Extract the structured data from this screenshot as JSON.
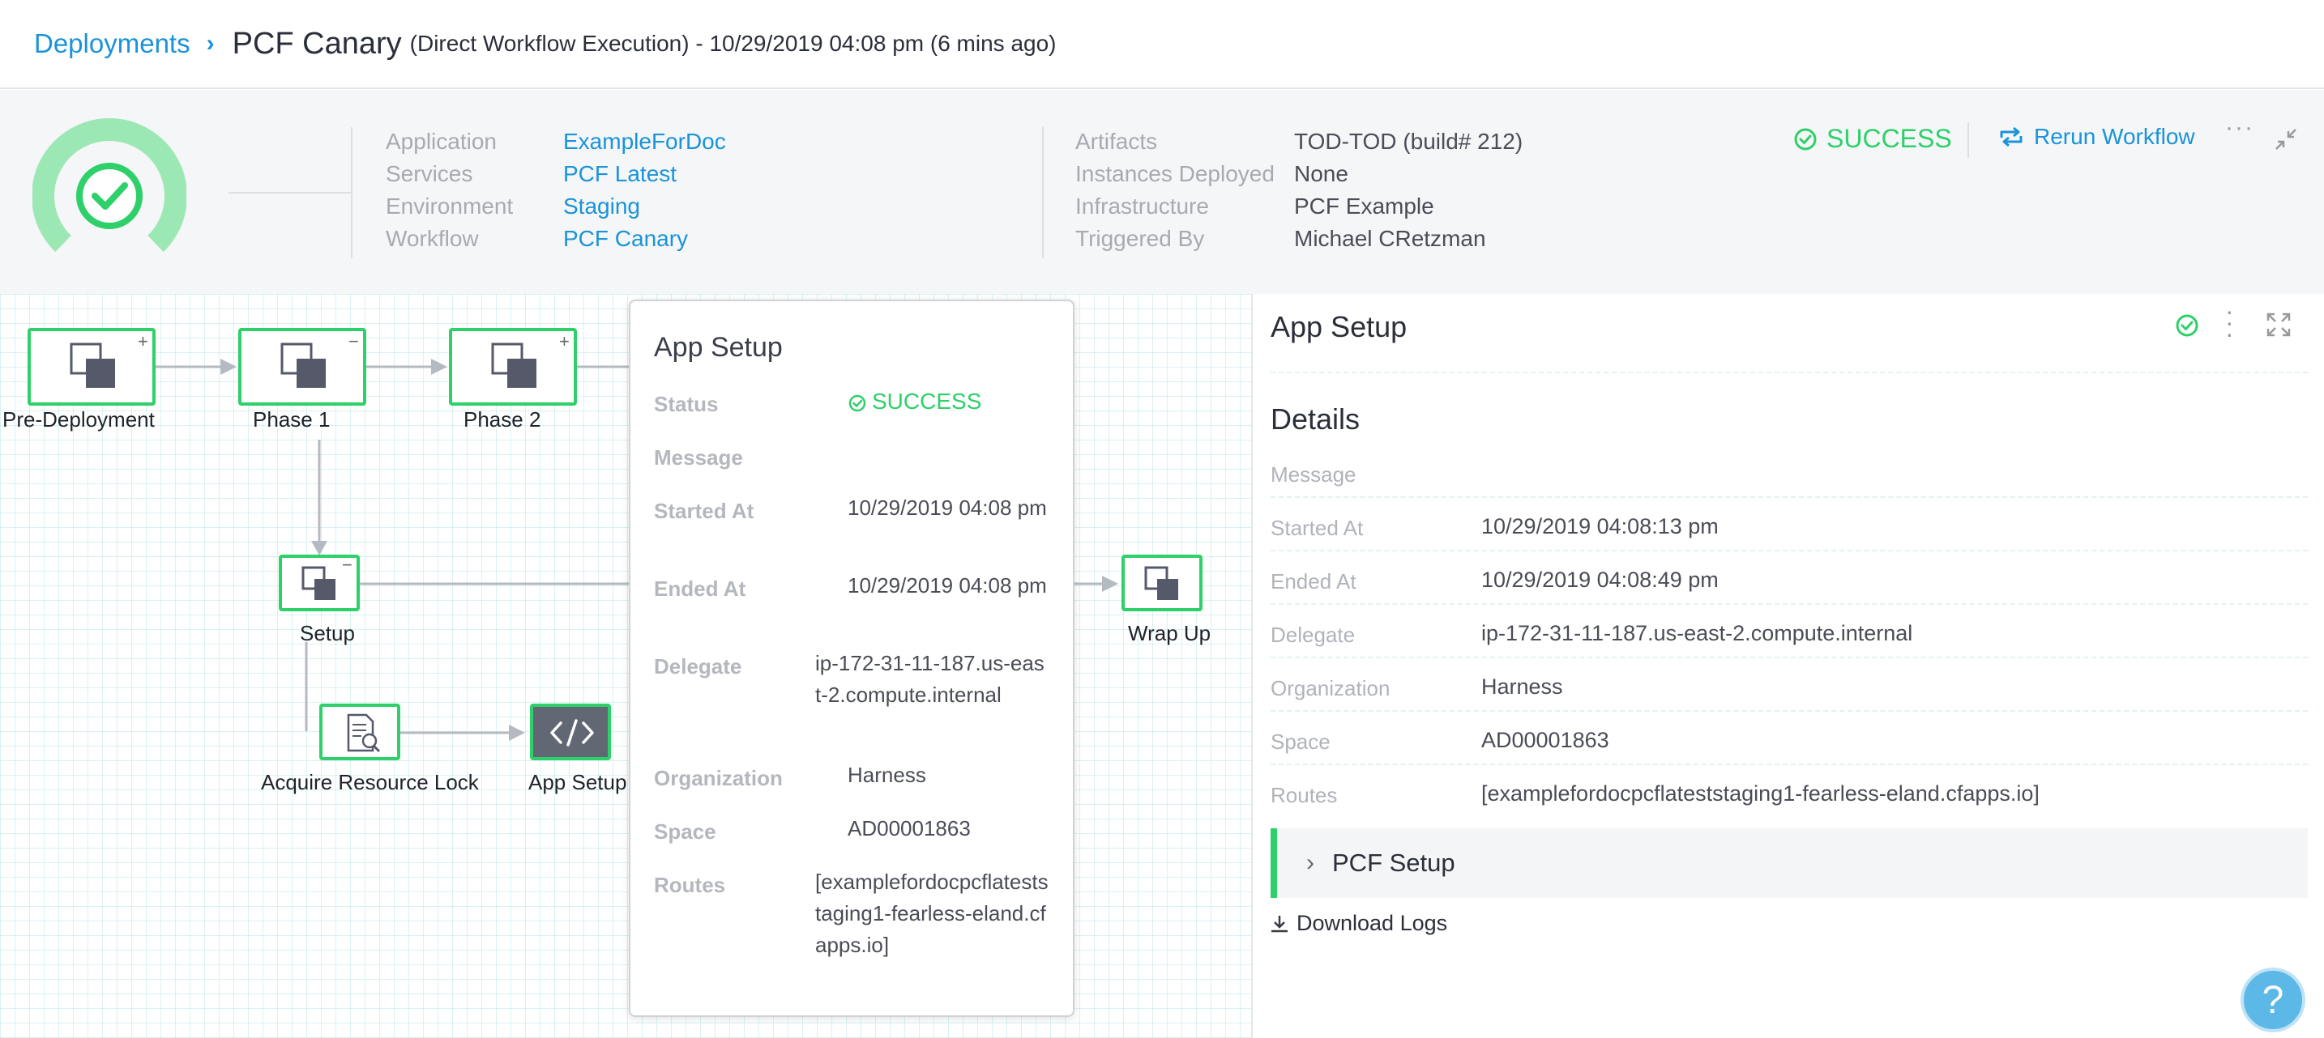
{
  "breadcrumb": {
    "root": "Deployments",
    "title": "PCF Canary",
    "subtitle": "(Direct Workflow Execution) - 10/29/2019 04:08 pm (6 mins ago)"
  },
  "summary": {
    "application_label": "Application",
    "application": "ExampleForDoc",
    "services_label": "Services",
    "services": "PCF Latest",
    "environment_label": "Environment",
    "environment": "Staging",
    "workflow_label": "Workflow",
    "workflow": "PCF Canary",
    "artifacts_label": "Artifacts",
    "artifacts": "TOD-TOD (build# 212)",
    "instances_label": "Instances Deployed",
    "instances": "None",
    "infrastructure_label": "Infrastructure",
    "infrastructure": "PCF Example",
    "triggered_label": "Triggered By",
    "triggered": "Michael CRetzman",
    "status": "SUCCESS",
    "rerun_label": "Rerun Workflow"
  },
  "graph": {
    "nodes": {
      "pre_deployment": "Pre-Deployment",
      "phase1": "Phase 1",
      "phase2": "Phase 2",
      "setup": "Setup",
      "wrap_up": "Wrap Up",
      "acquire_lock": "Acquire Resource Lock",
      "app_setup": "App Setup"
    },
    "toggles": {
      "plus": "+",
      "minus": "−"
    }
  },
  "popover": {
    "title": "App Setup",
    "status_label": "Status",
    "status": "SUCCESS",
    "message_label": "Message",
    "started_label": "Started At",
    "started": "10/29/2019 04:08 pm",
    "ended_label": "Ended At",
    "ended": "10/29/2019 04:08 pm",
    "delegate_label": "Delegate",
    "delegate": "ip-172-31-11-187.us-east-2.compute.internal",
    "organization_label": "Organization",
    "organization": "Harness",
    "space_label": "Space",
    "space": "AD00001863",
    "routes_label": "Routes",
    "routes": "[examplefordocpcflateststaging1-fearless-eland.cfapps.io]"
  },
  "details": {
    "title": "App Setup",
    "section": "Details",
    "message_label": "Message",
    "started_label": "Started At",
    "started": "10/29/2019 04:08:13 pm",
    "ended_label": "Ended At",
    "ended": "10/29/2019 04:08:49 pm",
    "delegate_label": "Delegate",
    "delegate": "ip-172-31-11-187.us-east-2.compute.internal",
    "organization_label": "Organization",
    "organization": "Harness",
    "space_label": "Space",
    "space": "AD00001863",
    "routes_label": "Routes",
    "routes": "[examplefordocpcflateststaging1-fearless-eland.cfapps.io]",
    "accordion": "PCF Setup",
    "download": "Download Logs"
  },
  "help": "?",
  "colors": {
    "accent": "#1a93d8",
    "success": "#2ed06a",
    "node_active": "#626873"
  }
}
